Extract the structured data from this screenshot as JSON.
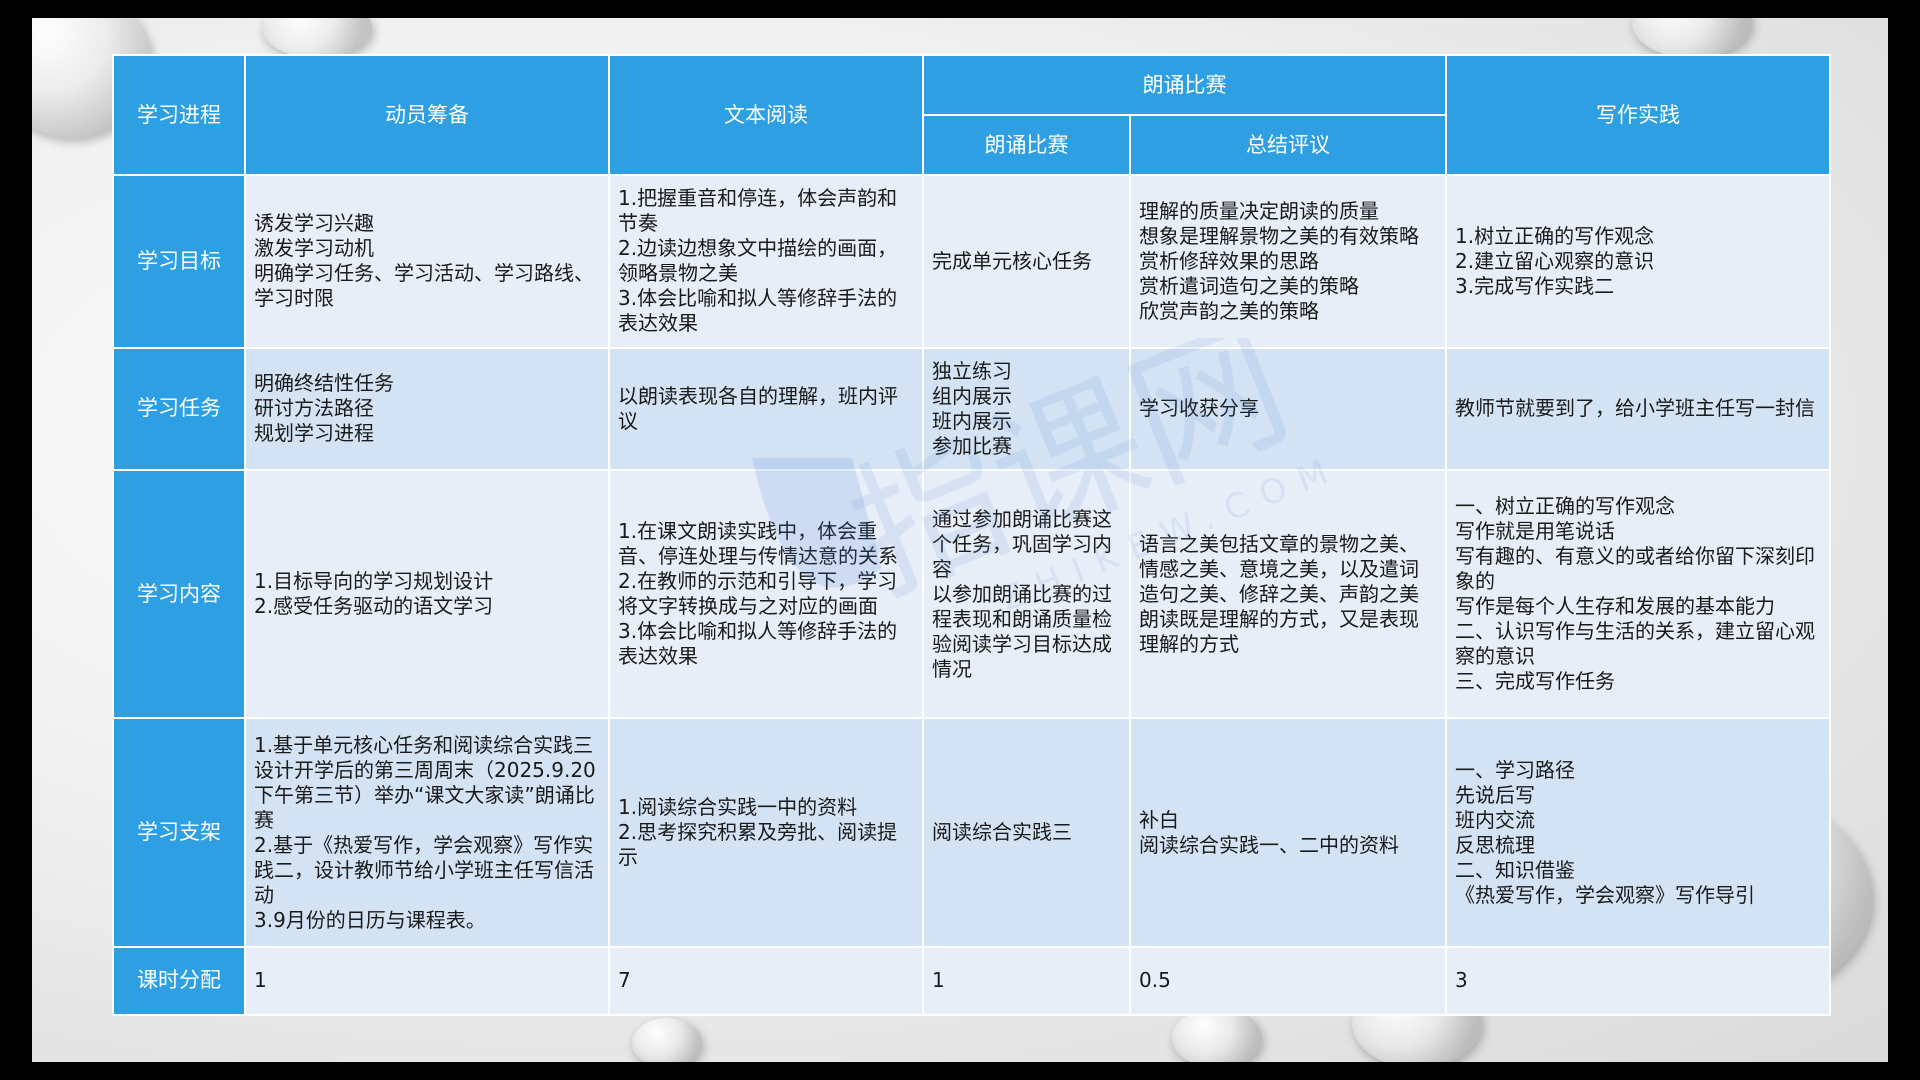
{
  "header": {
    "col0": "学习进程",
    "col1": "动员筹备",
    "col2": "文本阅读",
    "group": "朗诵比赛",
    "sub1": "朗诵比赛",
    "sub2": "总结评议",
    "col5": "写作实践"
  },
  "rows": [
    {
      "label": "学习目标",
      "cells": [
        [
          "诱发学习兴趣",
          "激发学习动机",
          "明确学习任务、学习活动、学习路线、学习时限"
        ],
        [
          "1.把握重音和停连，体会声韵和节奏",
          "2.边读边想象文中描绘的画面，领略景物之美",
          "3.体会比喻和拟人等修辞手法的表达效果"
        ],
        [
          "完成单元核心任务"
        ],
        [
          "理解的质量决定朗读的质量",
          "想象是理解景物之美的有效策略",
          "赏析修辞效果的思路",
          "赏析遣词造句之美的策略",
          "欣赏声韵之美的策略"
        ],
        [
          "1.树立正确的写作观念",
          "2.建立留心观察的意识",
          "3.完成写作实践二"
        ]
      ]
    },
    {
      "label": "学习任务",
      "cells": [
        [
          "明确终结性任务",
          "研讨方法路径",
          "规划学习进程"
        ],
        [
          "以朗读表现各自的理解，班内评议"
        ],
        [
          "独立练习",
          "组内展示",
          "班内展示",
          "参加比赛"
        ],
        [
          "学习收获分享"
        ],
        [
          "教师节就要到了，给小学班主任写一封信"
        ]
      ]
    },
    {
      "label": "学习内容",
      "cells": [
        [
          "1.目标导向的学习规划设计",
          "2.感受任务驱动的语文学习"
        ],
        [
          "1.在课文朗读实践中，体会重音、停连处理与传情达意的关系",
          "2.在教师的示范和引导下，学习将文字转换成与之对应的画面",
          "3.体会比喻和拟人等修辞手法的表达效果"
        ],
        [
          "通过参加朗诵比赛这个任务，巩固学习内容",
          "以参加朗诵比赛的过程表现和朗诵质量检验阅读学习目标达成情况"
        ],
        [
          "语言之美包括文章的景物之美、情感之美、意境之美，以及遣词造句之美、修辞之美、声韵之美",
          "朗读既是理解的方式，又是表现理解的方式"
        ],
        [
          "一、树立正确的写作观念",
          "写作就是用笔说话",
          "写有趣的、有意义的或者给你留下深刻印象的",
          "写作是每个人生存和发展的基本能力",
          "二、认识写作与生活的关系，建立留心观察的意识",
          "三、完成写作任务"
        ]
      ]
    },
    {
      "label": "学习支架",
      "cells": [
        [
          "1.基于单元核心任务和阅读综合实践三设计开学后的第三周周末（2025.9.20下午第三节）举办“课文大家读”朗诵比赛",
          "2.基于《热爱写作，学会观察》写作实践二，设计教师节给小学班主任写信活动",
          "3.9月份的日历与课程表。"
        ],
        [
          "1.阅读综合实践一中的资料",
          "2.思考探究积累及旁批、阅读提示"
        ],
        [
          "阅读综合实践三"
        ],
        [
          "补白",
          "阅读综合实践一、二中的资料"
        ],
        [
          "一、学习路径",
          "先说后写",
          "班内交流",
          "反思梳理",
          "二、知识借鉴",
          "《热爱写作，学会观察》写作导引"
        ]
      ]
    },
    {
      "label": "课时分配",
      "cells": [
        [
          "1"
        ],
        [
          "7"
        ],
        [
          "1"
        ],
        [
          "0.5"
        ],
        [
          "3"
        ]
      ]
    }
  ],
  "watermark": {
    "brand": "指课网",
    "domain": "ZHIKEW.COM"
  }
}
